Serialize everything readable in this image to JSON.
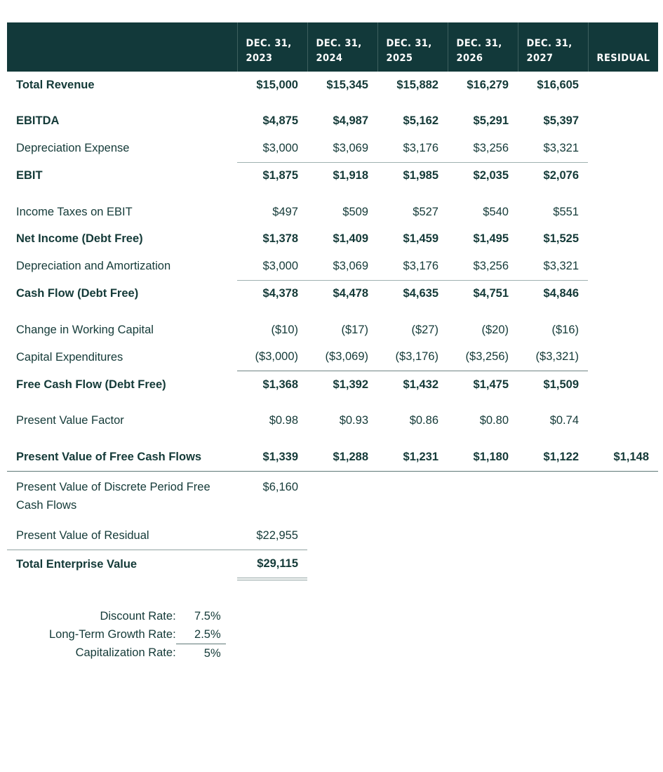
{
  "header": {
    "columns": [
      {
        "line1": "DEC. 31,",
        "line2": "2023"
      },
      {
        "line1": "DEC. 31,",
        "line2": "2024"
      },
      {
        "line1": "DEC. 31,",
        "line2": "2025"
      },
      {
        "line1": "DEC. 31,",
        "line2": "2026"
      },
      {
        "line1": "DEC. 31,",
        "line2": "2027"
      },
      {
        "line1": "",
        "line2": "RESIDUAL"
      }
    ]
  },
  "rows": {
    "total_revenue": {
      "label": "Total Revenue",
      "values": [
        "$15,000",
        "$15,345",
        "$15,882",
        "$16,279",
        "$16,605",
        ""
      ]
    },
    "ebitda": {
      "label": "EBITDA",
      "values": [
        "$4,875",
        "$4,987",
        "$5,162",
        "$5,291",
        "$5,397",
        ""
      ]
    },
    "depreciation_expense": {
      "label": "Depreciation Expense",
      "values": [
        "$3,000",
        "$3,069",
        "$3,176",
        "$3,256",
        "$3,321",
        ""
      ]
    },
    "ebit": {
      "label": "EBIT",
      "values": [
        "$1,875",
        "$1,918",
        "$1,985",
        "$2,035",
        "$2,076",
        ""
      ]
    },
    "income_taxes": {
      "label": "Income Taxes on EBIT",
      "values": [
        "$497",
        "$509",
        "$527",
        "$540",
        "$551",
        ""
      ]
    },
    "net_income": {
      "label": "Net Income (Debt Free)",
      "values": [
        "$1,378",
        "$1,409",
        "$1,459",
        "$1,495",
        "$1,525",
        ""
      ]
    },
    "dep_amort": {
      "label": "Depreciation and Amortization",
      "values": [
        "$3,000",
        "$3,069",
        "$3,176",
        "$3,256",
        "$3,321",
        ""
      ]
    },
    "cash_flow": {
      "label": "Cash Flow (Debt Free)",
      "values": [
        "$4,378",
        "$4,478",
        "$4,635",
        "$4,751",
        "$4,846",
        ""
      ]
    },
    "change_wc": {
      "label": "Change in Working Capital",
      "values": [
        "($10)",
        "($17)",
        "($27)",
        "($20)",
        "($16)",
        ""
      ]
    },
    "capex": {
      "label": "Capital Expenditures",
      "values": [
        "($3,000)",
        "($3,069)",
        "($3,176)",
        "($3,256)",
        "($3,321)",
        ""
      ]
    },
    "fcf": {
      "label": "Free Cash Flow (Debt Free)",
      "values": [
        "$1,368",
        "$1,392",
        "$1,432",
        "$1,475",
        "$1,509",
        ""
      ]
    },
    "pv_factor": {
      "label": "Present Value Factor",
      "values": [
        "$0.98",
        "$0.93",
        "$0.86",
        "$0.80",
        "$0.74",
        ""
      ]
    },
    "pv_fcf": {
      "label": "Present Value of Free Cash Flows",
      "values": [
        "$1,339",
        "$1,288",
        "$1,231",
        "$1,180",
        "$1,122",
        "$1,148"
      ]
    }
  },
  "summary": {
    "pv_discrete": {
      "label": "Present Value of Discrete Period Free Cash Flows",
      "value": "$6,160"
    },
    "pv_residual": {
      "label": "Present Value of Residual",
      "value": "$22,955"
    },
    "total_ev": {
      "label": "Total Enterprise Value",
      "value": "$29,115"
    }
  },
  "rates": [
    {
      "label": "Discount Rate:",
      "value": "7.5%"
    },
    {
      "label": "Long-Term Growth Rate:",
      "value": "2.5%"
    },
    {
      "label": "Capitalization Rate:",
      "value": "5%"
    }
  ]
}
